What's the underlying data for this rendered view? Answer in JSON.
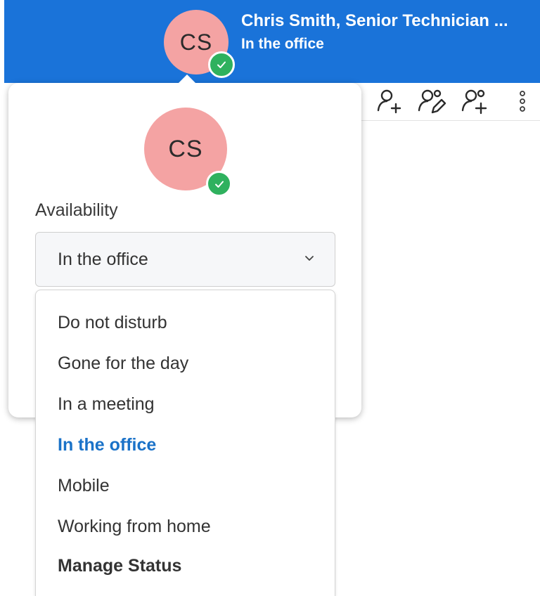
{
  "header": {
    "avatar_initials": "CS",
    "user_name": "Chris Smith, Senior Technician ...",
    "status_text": "In the office",
    "background_color": "#1a73d9",
    "status_icon": "check-circle-icon"
  },
  "toolbar": {
    "icons": [
      "add-person-icon",
      "edit-people-icon",
      "add-group-icon",
      "more-vertical-icon"
    ]
  },
  "popover": {
    "avatar_initials": "CS",
    "availability_label": "Availability",
    "select": {
      "value": "In the office",
      "chevron_icon": "chevron-down-icon"
    },
    "options": [
      {
        "label": "Do not disturb"
      },
      {
        "label": "Gone for the day"
      },
      {
        "label": "In a meeting"
      },
      {
        "label": "In the office",
        "selected": true
      },
      {
        "label": "Mobile"
      },
      {
        "label": "Working from home"
      },
      {
        "label": "Manage Status",
        "emphasis": true
      }
    ]
  },
  "colors": {
    "accent": "#1a72c8",
    "avatar": "#f4a3a3",
    "available_green": "#2fb15e"
  }
}
